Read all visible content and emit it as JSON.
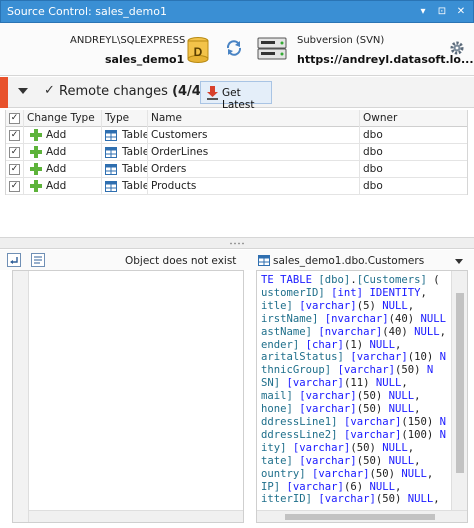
{
  "window": {
    "title": "Source Control: sales_demo1",
    "buttons": {
      "dropdown": "▾",
      "pin": "⊡",
      "close": "✕"
    }
  },
  "header": {
    "server_name": "ANDREYL\\SQLEXPRESS",
    "database_name": "sales_demo1",
    "source_control_label": "Subversion (SVN)",
    "repository_url": "https://andreyl.datasoft.lo..."
  },
  "changes": {
    "title": "Remote changes",
    "count": "(4/4)",
    "get_latest_label": "Get Latest"
  },
  "table": {
    "columns": [
      "Change Type",
      "Type",
      "Name",
      "Owner"
    ],
    "rows": [
      {
        "change_type": "Add",
        "type": "Table",
        "name": "Customers",
        "owner": "dbo"
      },
      {
        "change_type": "Add",
        "type": "Table",
        "name": "OrderLines",
        "owner": "dbo"
      },
      {
        "change_type": "Add",
        "type": "Table",
        "name": "Orders",
        "owner": "dbo"
      },
      {
        "change_type": "Add",
        "type": "Table",
        "name": "Products",
        "owner": "dbo"
      }
    ]
  },
  "compare": {
    "left_status": "Object does not exist",
    "right_object": "sales_demo1.dbo.Customers"
  },
  "colors": {
    "titlebar": "#3a8fd4",
    "accent": "#e8522c",
    "keyword": "#1a1aff",
    "identifier": "#1f6f8b"
  }
}
